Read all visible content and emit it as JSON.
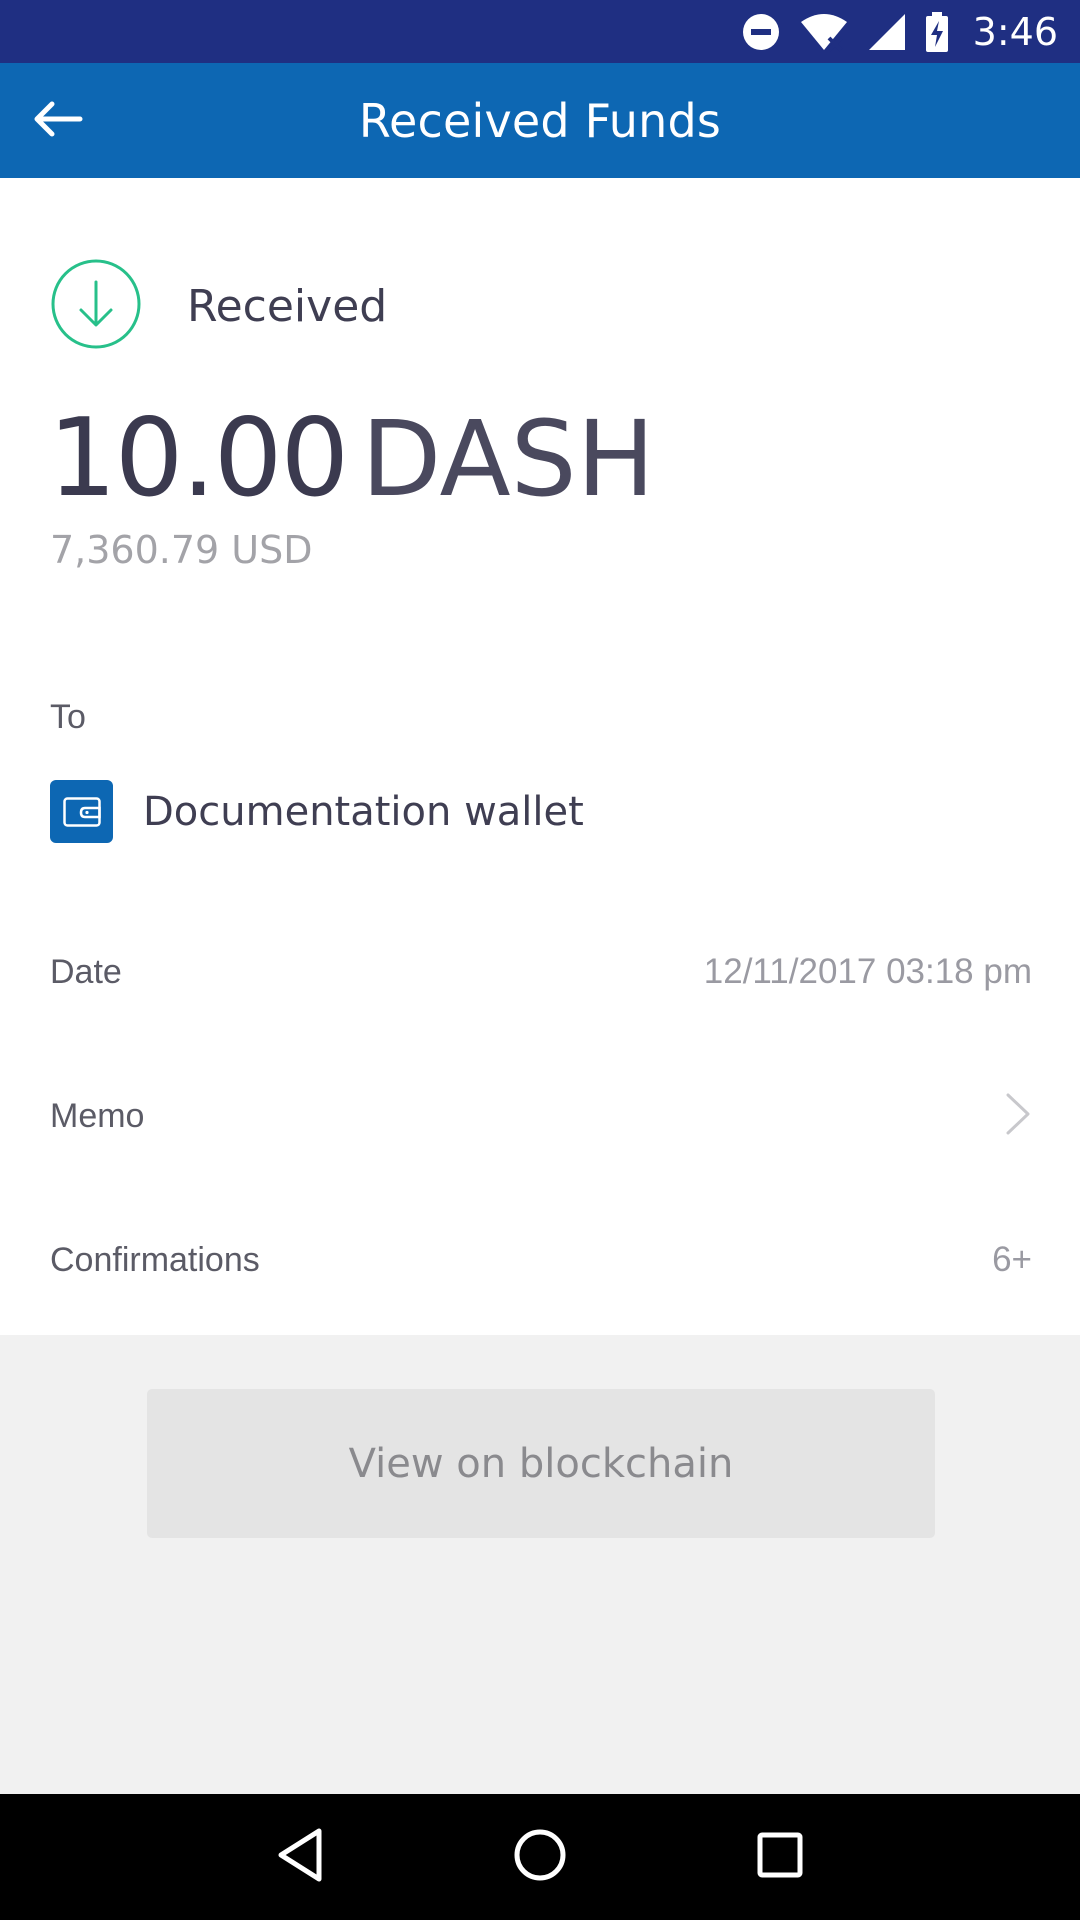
{
  "status_bar": {
    "time": "3:46",
    "icons": [
      "do-not-disturb-icon",
      "wifi-icon",
      "signal-icon",
      "battery-charging-icon"
    ],
    "bg_color": "#1f2f82"
  },
  "app_bar": {
    "title": "Received Funds",
    "back_icon": "arrow-left-icon",
    "bg_color": "#0d67b3"
  },
  "transaction": {
    "status_label": "Received",
    "status_icon": "arrow-down-circle-icon",
    "status_color": "#27c08a",
    "amount_value": "10.00",
    "amount_unit": "DASH",
    "fiat_value": "7,360.79 USD"
  },
  "to": {
    "label": "To",
    "wallet_icon": "wallet-icon",
    "wallet_name": "Documentation wallet"
  },
  "details": {
    "date_label": "Date",
    "date_value": "12/11/2017 03:18 pm",
    "memo_label": "Memo",
    "memo_icon": "chevron-right-icon",
    "confirmations_label": "Confirmations",
    "confirmations_value": "6+"
  },
  "actions": {
    "view_blockchain_label": "View on blockchain"
  },
  "nav_bar": {
    "icons": [
      "back-triangle-icon",
      "home-circle-icon",
      "recents-square-icon"
    ]
  }
}
